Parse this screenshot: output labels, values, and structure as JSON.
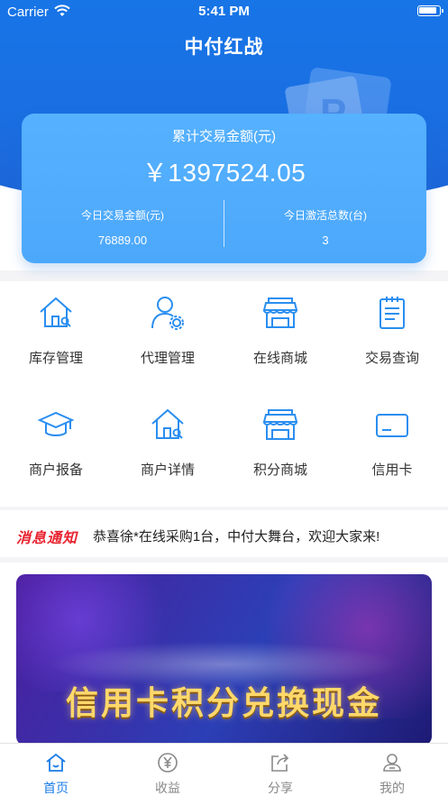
{
  "status_bar": {
    "carrier": "Carrier",
    "time": "5:41 PM"
  },
  "app_title": "中付红战",
  "summary": {
    "total_label": "累计交易金额(元)",
    "total_value": "￥1397524.05",
    "today_amount_label": "今日交易金额(元)",
    "today_amount_value": "76889.00",
    "today_activated_label": "今日激活总数(台)",
    "today_activated_value": "3"
  },
  "menu": {
    "items": [
      {
        "label": "库存管理",
        "icon": "house-search-icon"
      },
      {
        "label": "代理管理",
        "icon": "user-gear-icon"
      },
      {
        "label": "在线商城",
        "icon": "storefront-icon"
      },
      {
        "label": "交易查询",
        "icon": "clipboard-list-icon"
      },
      {
        "label": "商户报备",
        "icon": "graduation-cap-icon"
      },
      {
        "label": "商户详情",
        "icon": "house-search-icon"
      },
      {
        "label": "积分商城",
        "icon": "storefront-icon"
      },
      {
        "label": "信用卡",
        "icon": "credit-card-icon"
      }
    ]
  },
  "notice": {
    "tag": "消息通知",
    "text": "恭喜徐*在线采购1台，中付大舞台，欢迎大家来!"
  },
  "banner": {
    "text": "信用卡积分兑换现金"
  },
  "tabbar": {
    "tabs": [
      {
        "label": "首页",
        "icon": "home-icon",
        "active": true
      },
      {
        "label": "收益",
        "icon": "yen-coin-icon",
        "active": false
      },
      {
        "label": "分享",
        "icon": "share-icon",
        "active": false
      },
      {
        "label": "我的",
        "icon": "profile-icon",
        "active": false
      }
    ]
  },
  "colors": {
    "primary": "#1b7ce8",
    "card": "#4ca8fb",
    "notice_red": "#e8232f",
    "icon_blue": "#2a8ef0"
  }
}
